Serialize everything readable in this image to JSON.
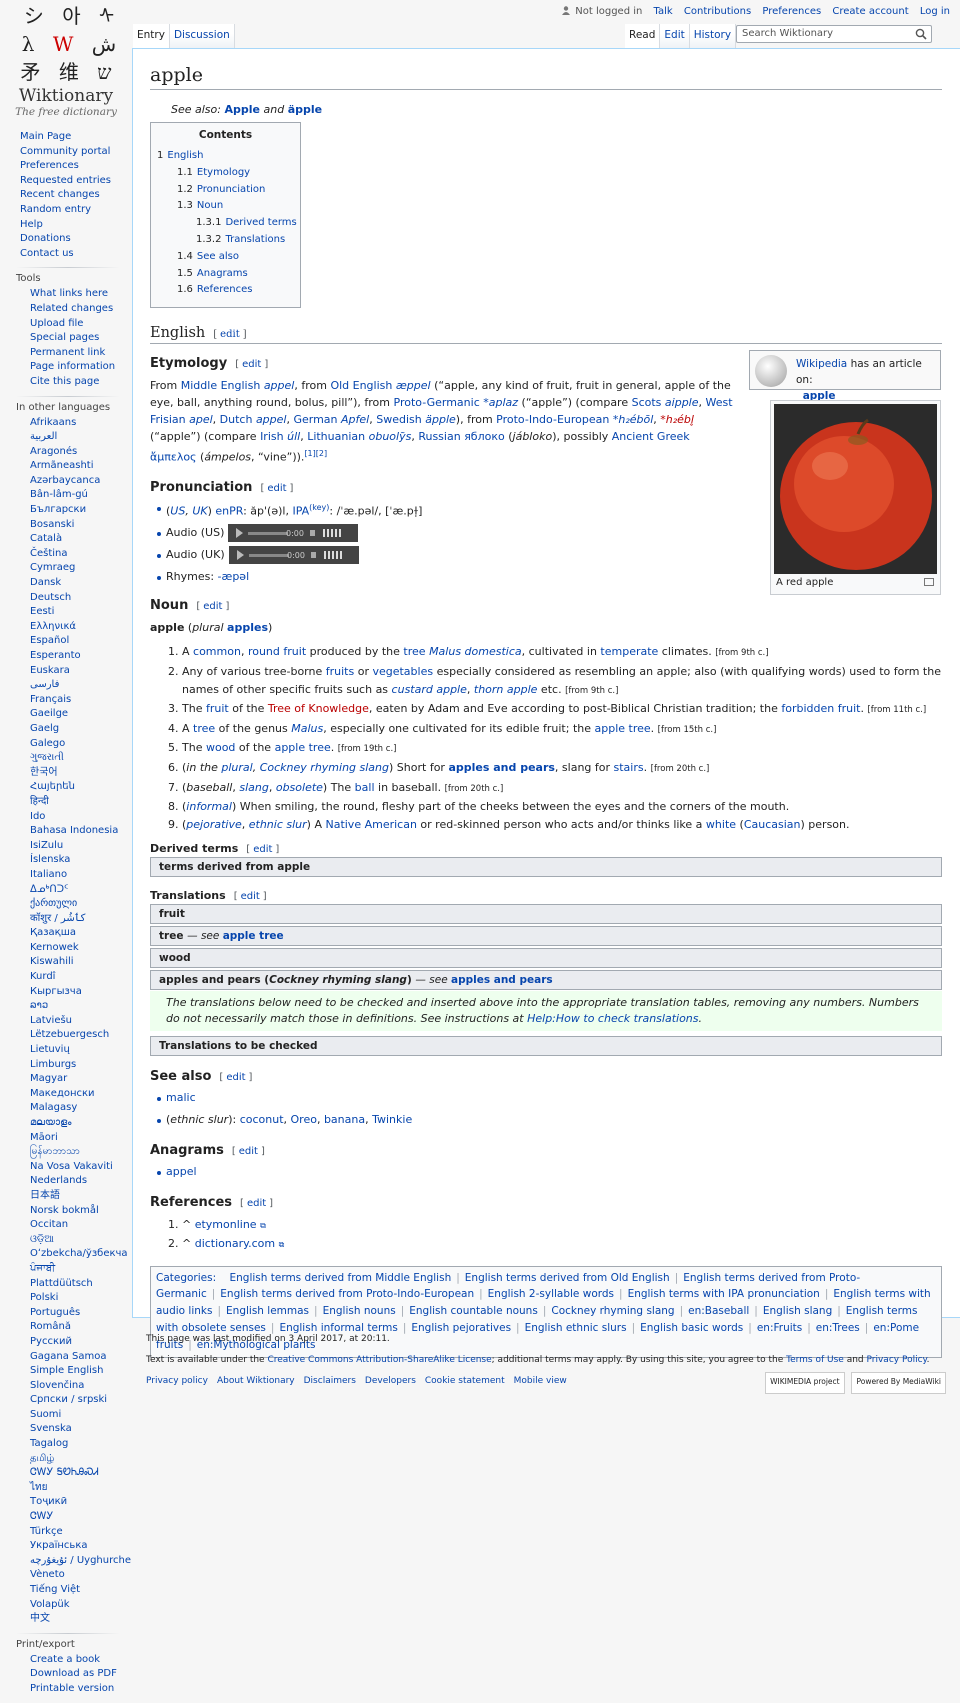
{
  "logo": {
    "wordmark": "Wiktionary",
    "tagline": "The free dictionary"
  },
  "personal": {
    "not_logged": "Not logged in",
    "links": [
      "Talk",
      "Contributions",
      "Preferences",
      "Create account",
      "Log in"
    ]
  },
  "tabs": {
    "left": [
      "Entry",
      "Discussion"
    ],
    "right": [
      "Read",
      "Edit",
      "History"
    ]
  },
  "search": {
    "placeholder": "Search Wiktionary"
  },
  "nav": {
    "main": [
      "Main Page",
      "Community portal",
      "Preferences",
      "Requested entries",
      "Recent changes",
      "Random entry",
      "Help",
      "Donations",
      "Contact us"
    ],
    "tools_heading": "Tools",
    "tools": [
      "What links here",
      "Related changes",
      "Upload file",
      "Special pages",
      "Permanent link",
      "Page information",
      "Cite this page"
    ],
    "lang_heading": "In other languages",
    "languages": [
      "Afrikaans",
      "العربية",
      "Aragonés",
      "Armãneashti",
      "Azərbaycanca",
      "Bân-lâm-gú",
      "Български",
      "Bosanski",
      "Català",
      "Čeština",
      "Cymraeg",
      "Dansk",
      "Deutsch",
      "Eesti",
      "Ελληνικά",
      "Español",
      "Esperanto",
      "Euskara",
      "فارسی",
      "Français",
      "Gaeilge",
      "Gaelg",
      "Galego",
      "ગુજરાતી",
      "한국어",
      "Հայերեն",
      "हिन्दी",
      "Ido",
      "Bahasa Indonesia",
      "IsiZulu",
      "Íslenska",
      "Italiano",
      "ᐃᓄᒃᑎᑐᑦ",
      "ქართული",
      "कॉशुर / کٲشُر",
      "Қазақша",
      "Kernowek",
      "Kiswahili",
      "Kurdî",
      "Кыргызча",
      "ລາວ",
      "Latviešu",
      "Lëtzebuergesch",
      "Lietuvių",
      "Limburgs",
      "Magyar",
      "Македонски",
      "Malagasy",
      "മലയാളം",
      "Māori",
      "မြန်မာဘာသာ",
      "Na Vosa Vakaviti",
      "Nederlands",
      "日本語",
      "Norsk bokmål",
      "Occitan",
      "ଓଡ଼ିଆ",
      "Oʻzbekcha/ўзбекча",
      "ਪੰਜਾਬੀ",
      "Plattdüütsch",
      "Polski",
      "Português",
      "Română",
      "Русский",
      "Gagana Samoa",
      "Simple English",
      "Slovenčina",
      "Српски / srpski",
      "Suomi",
      "Svenska",
      "Tagalog",
      "தமிழ்",
      "ᏣᎳᎩ ᎦᏬᏂᎯᏍᏗ",
      "ไทย",
      "Тоҷикӣ",
      "ᏣᎳᎩ",
      "Türkçe",
      "Українська",
      "ئۇيغۇرچە / Uyghurche",
      "Vèneto",
      "Tiếng Việt",
      "Volapük",
      "中文"
    ],
    "print_heading": "Print/export",
    "print": [
      "Create a book",
      "Download as PDF",
      "Printable version"
    ]
  },
  "page": {
    "title": "apple",
    "see_also_label": "See also:",
    "see_also_a": "Apple",
    "see_also_and": "and",
    "see_also_b": "äpple",
    "toc_title": "Contents",
    "toc": [
      {
        "num": "1",
        "label": "English",
        "level": 1
      },
      {
        "num": "1.1",
        "label": "Etymology",
        "level": 2
      },
      {
        "num": "1.2",
        "label": "Pronunciation",
        "level": 2
      },
      {
        "num": "1.3",
        "label": "Noun",
        "level": 2
      },
      {
        "num": "1.3.1",
        "label": "Derived terms",
        "level": 3
      },
      {
        "num": "1.3.2",
        "label": "Translations",
        "level": 3
      },
      {
        "num": "1.4",
        "label": "See also",
        "level": 2
      },
      {
        "num": "1.5",
        "label": "Anagrams",
        "level": 2
      },
      {
        "num": "1.6",
        "label": "References",
        "level": 2
      }
    ],
    "edit": "edit",
    "h_english": "English",
    "h_etym": "Etymology",
    "h_pron": "Pronunciation",
    "h_noun": "Noun",
    "h_derived": "Derived terms",
    "h_trans": "Translations",
    "h_seealso": "See also",
    "h_anagrams": "Anagrams",
    "h_refs": "References",
    "wiki_box": {
      "site": "Wikipedia",
      "text": "has an article on:",
      "article": "apple"
    },
    "thumb_caption": "A red apple",
    "pron": {
      "audio_us": "Audio (US)",
      "audio_uk": "Audio (UK)",
      "rhymes_label": "Rhymes:",
      "rhymes": "-æpəl",
      "player_time": "0:00"
    },
    "headword": {
      "word": "apple",
      "plural_label": "plural",
      "plural": "apples"
    },
    "derived_box": "terms derived from apple",
    "trans_boxes": [
      "fruit",
      "wood"
    ],
    "trans_tree": {
      "label": "tree",
      "see": "see",
      "target": "apple tree"
    },
    "trans_aap": {
      "label": "apples and pears",
      "note": "Cockney rhyming slang",
      "see": "see",
      "target": "apples and pears"
    },
    "check_note": "The translations below need to be checked and inserted above into the appropriate translation tables, removing any numbers. Numbers do not necessarily match those in definitions. See instructions at",
    "check_link": "Help:How to check translations",
    "check_box": "Translations to be checked",
    "see_also_items": [
      "malic"
    ],
    "anagram": "appel",
    "refs": [
      "etymonline",
      "dictionary.com"
    ],
    "categories_label": "Categories:",
    "categories": [
      "English terms derived from Middle English",
      "English terms derived from Old English",
      "English terms derived from Proto-Germanic",
      "English terms derived from Proto-Indo-European",
      "English 2-syllable words",
      "English terms with IPA pronunciation",
      "English terms with audio links",
      "English lemmas",
      "English nouns",
      "English countable nouns",
      "Cockney rhyming slang",
      "en:Baseball",
      "English slang",
      "English terms with obsolete senses",
      "English informal terms",
      "English pejoratives",
      "English ethnic slurs",
      "English basic words",
      "en:Fruits",
      "en:Trees",
      "en:Pome fruits",
      "en:Mythological plants"
    ]
  },
  "footer": {
    "modified": "This page was last modified on 3 April 2017, at 20:11.",
    "license_pre": "Text is available under the",
    "license": "Creative Commons Attribution-ShareAlike License",
    "license_mid": "; additional terms may apply. By using this site, you agree to the",
    "terms": "Terms of Use",
    "and": "and",
    "privacy": "Privacy Policy",
    "places": [
      "Privacy policy",
      "About Wiktionary",
      "Disclaimers",
      "Developers",
      "Cookie statement",
      "Mobile view"
    ],
    "badge1": "WIKIMEDIA project",
    "badge2": "Powered By MediaWiki"
  }
}
